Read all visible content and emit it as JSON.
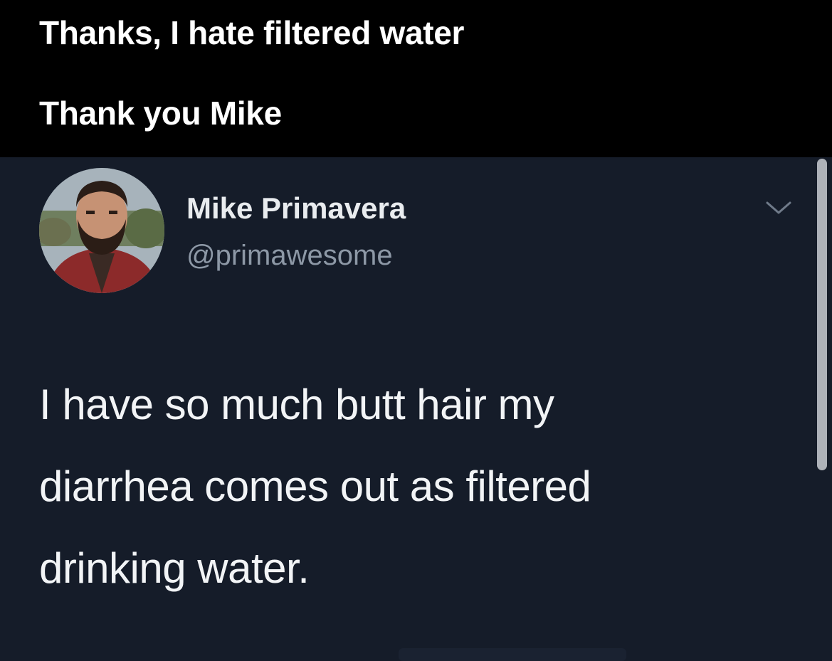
{
  "caption": {
    "line1": "Thanks, I hate filtered water",
    "line2": "Thank you Mike"
  },
  "tweet": {
    "author": {
      "display_name": "Mike Primavera",
      "handle": "@primawesome"
    },
    "text_lines": [
      "I have so much butt hair my",
      "diarrhea comes out as filtered",
      "drinking water."
    ],
    "menu_icon": "chevron-down-icon"
  },
  "colors": {
    "caption_bg": "#000000",
    "tweet_bg": "#151c29",
    "name_text": "#e9ecef",
    "handle_text": "#8d98a6"
  }
}
